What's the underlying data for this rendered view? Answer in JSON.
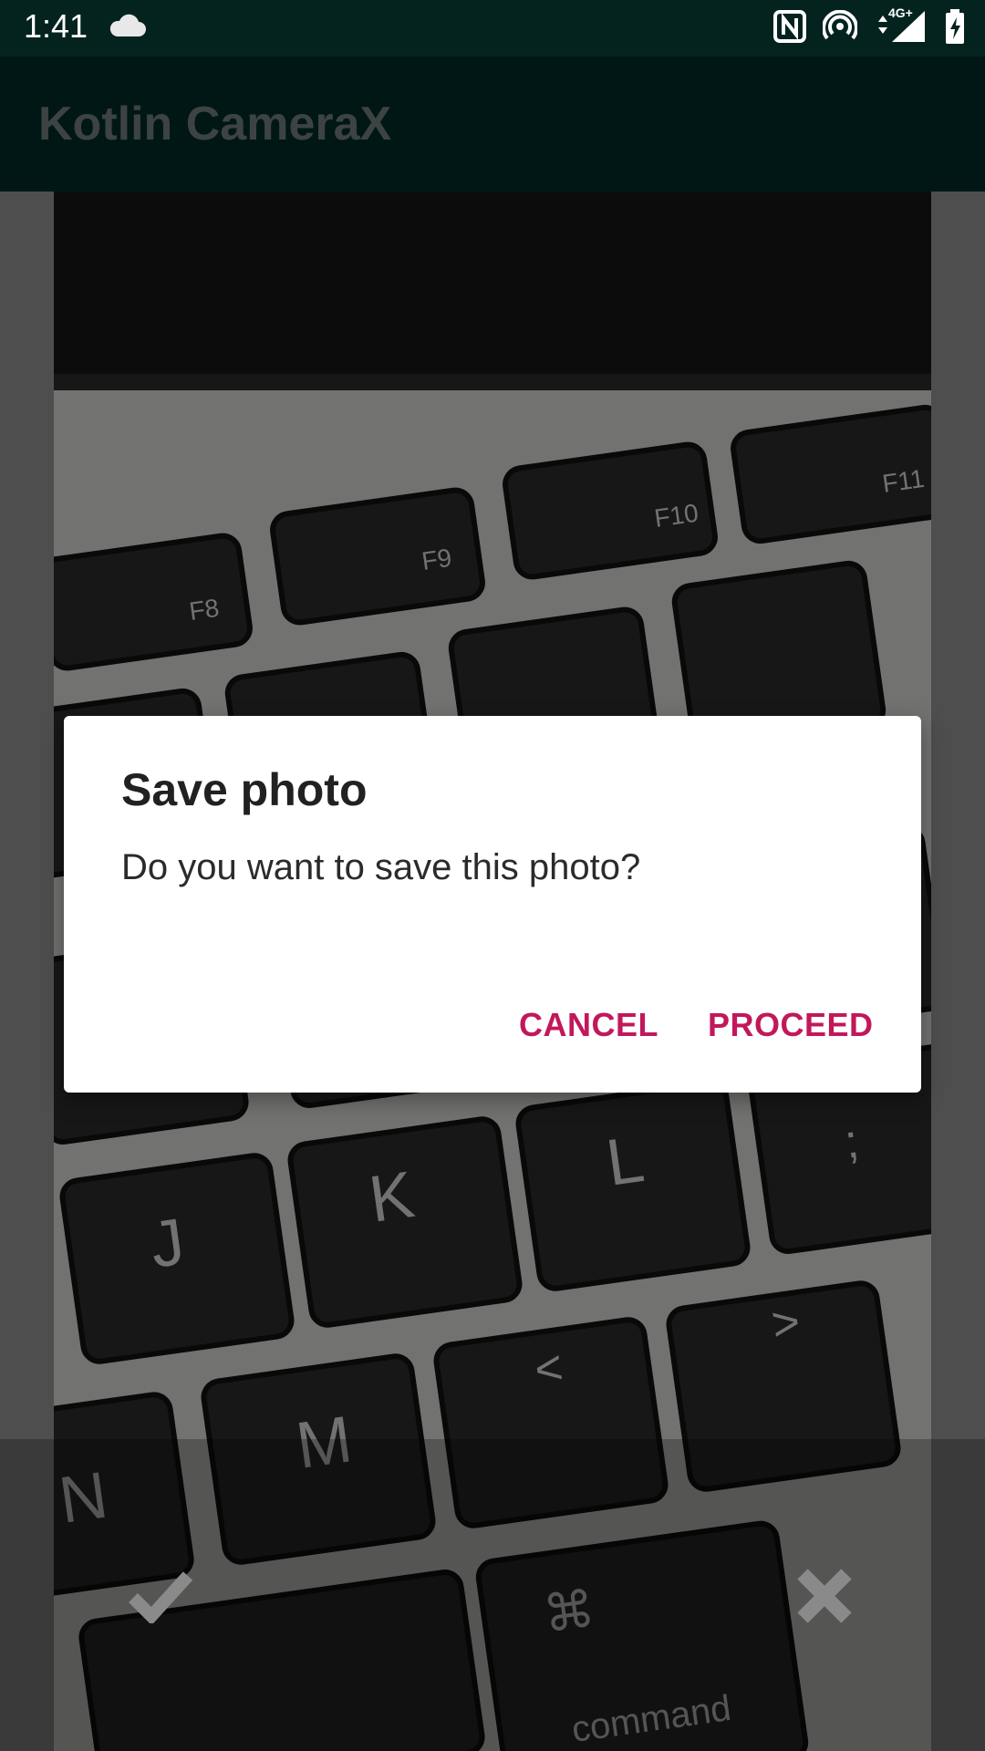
{
  "status_bar": {
    "time": "1:41",
    "network_label": "4G+",
    "icons": [
      "cloud-icon",
      "nfc-icon",
      "hotspot-icon",
      "data-arrows-icon",
      "signal-icon",
      "battery-charging-icon"
    ]
  },
  "app_bar": {
    "title": "Kotlin CameraX"
  },
  "dialog": {
    "title": "Save photo",
    "message": "Do you want to save this photo?",
    "cancel_label": "CANCEL",
    "proceed_label": "PROCEED",
    "accent_color": "#c2185b"
  },
  "photo": {
    "description_icons": [
      "checkmark-icon",
      "close-icon"
    ],
    "key_labels": [
      "F8",
      "F9",
      "F10",
      "F11",
      "K",
      "L",
      "J",
      "M",
      "N",
      "command",
      "⌘",
      ";",
      ">",
      "<"
    ]
  },
  "colors": {
    "status_bar": "#04231f",
    "app_bar": "#012b28",
    "accent": "#c2185b"
  }
}
